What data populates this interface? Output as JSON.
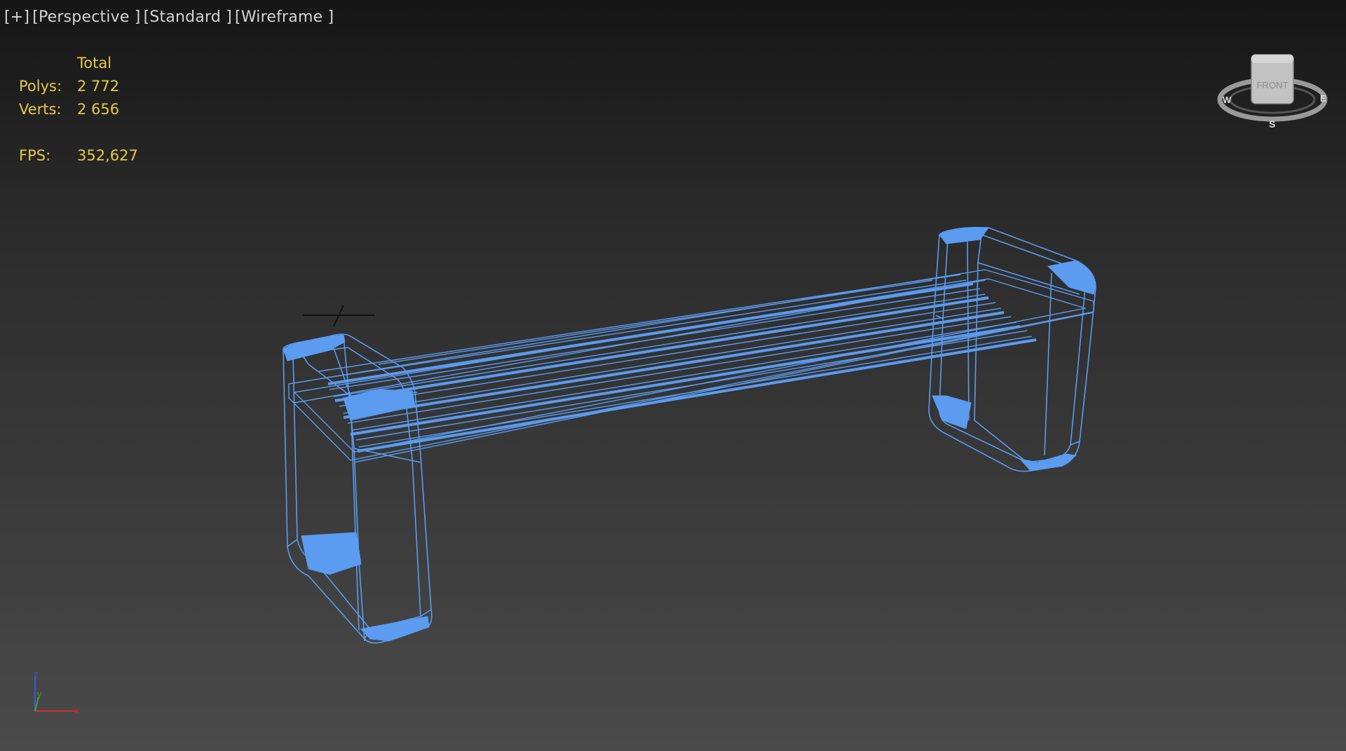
{
  "viewport": {
    "labels": [
      "[+]",
      "[Perspective ]",
      "[Standard ]",
      "[Wireframe ]"
    ]
  },
  "stats": {
    "header": "Total",
    "polys_label": "Polys:",
    "polys_value": "2 772",
    "verts_label": "Verts:",
    "verts_value": "2 656",
    "fps_label": "FPS:",
    "fps_value": "352,627"
  },
  "viewcube": {
    "face_label": "FRONT",
    "compass": {
      "west": "W",
      "east": "E",
      "south": "S"
    }
  },
  "axis": {
    "z": "z",
    "y": "y",
    "x": "x"
  },
  "colors": {
    "wireframe": "#5b9bf0",
    "stats_text": "#e6c84a",
    "label_text": "#d4d4d4"
  },
  "icons": [
    "viewcube-icon",
    "axis-tripod-icon"
  ]
}
